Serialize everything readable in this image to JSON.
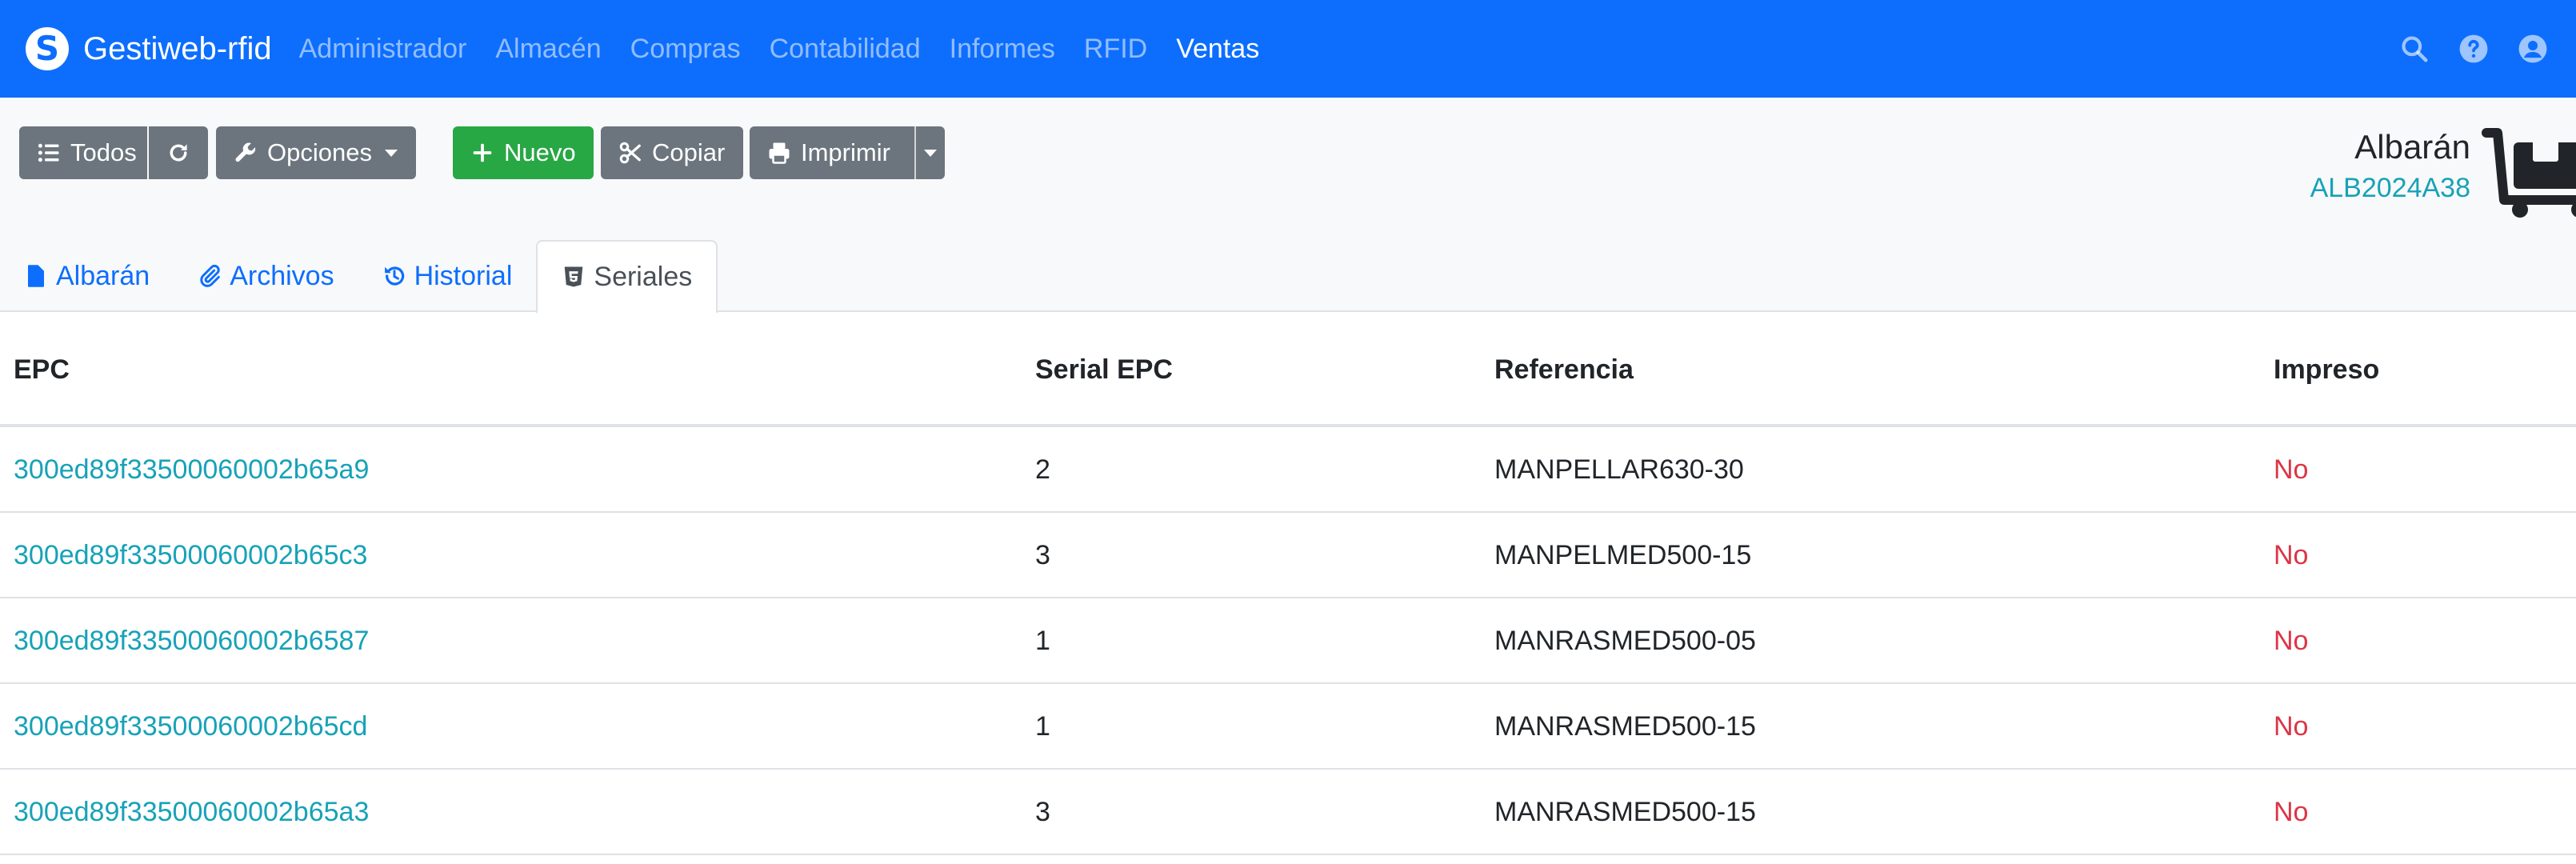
{
  "app": {
    "brand_glyph": "S",
    "brand": "Gestiweb-rfid",
    "brand_color": "#0d6efd"
  },
  "nav": {
    "items": [
      {
        "label": "Administrador",
        "active": false
      },
      {
        "label": "Almacén",
        "active": false
      },
      {
        "label": "Compras",
        "active": false
      },
      {
        "label": "Contabilidad",
        "active": false
      },
      {
        "label": "Informes",
        "active": false
      },
      {
        "label": "RFID",
        "active": false
      },
      {
        "label": "Ventas",
        "active": true
      }
    ],
    "icons": [
      "search-icon",
      "help-icon",
      "user-icon"
    ]
  },
  "toolbar": {
    "todos_label": "Todos",
    "opciones_label": "Opciones",
    "nuevo_label": "Nuevo",
    "copiar_label": "Copiar",
    "imprimir_label": "Imprimir"
  },
  "document": {
    "title": "Albarán",
    "code": "ALB2024A38"
  },
  "tabs": [
    {
      "label": "Albarán",
      "icon": "file-icon",
      "active": false
    },
    {
      "label": "Archivos",
      "icon": "paperclip-icon",
      "active": false
    },
    {
      "label": "Historial",
      "icon": "history-icon",
      "active": false
    },
    {
      "label": "Seriales",
      "icon": "html5-icon",
      "active": true
    }
  ],
  "table": {
    "headers": [
      "EPC",
      "Serial EPC",
      "Referencia",
      "Impreso"
    ],
    "rows": [
      {
        "epc": "300ed89f33500060002b65a9",
        "serial": "2",
        "ref": "MANPELLAR630-30",
        "impreso": "No"
      },
      {
        "epc": "300ed89f33500060002b65c3",
        "serial": "3",
        "ref": "MANPELMED500-15",
        "impreso": "No"
      },
      {
        "epc": "300ed89f33500060002b6587",
        "serial": "1",
        "ref": "MANRASMED500-05",
        "impreso": "No"
      },
      {
        "epc": "300ed89f33500060002b65cd",
        "serial": "1",
        "ref": "MANRASMED500-15",
        "impreso": "No"
      },
      {
        "epc": "300ed89f33500060002b65a3",
        "serial": "3",
        "ref": "MANRASMED500-15",
        "impreso": "No"
      }
    ]
  }
}
